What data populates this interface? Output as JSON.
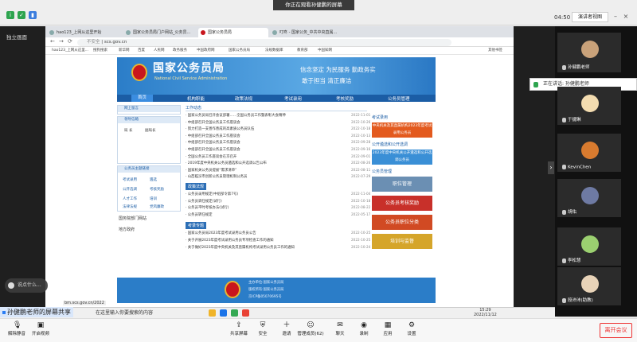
{
  "meeting": {
    "share_banner": "你正在观看孙健鹏的屏幕",
    "time": "04:50",
    "layout_label": "演讲者视图",
    "self_tag": "独立画面",
    "speaking_text": "正在讲话: 孙健鹏老师",
    "sharing_label": "孙健鹏老师的屏幕共享",
    "speech_bubble": "说点什么...",
    "end_button": "离开会议"
  },
  "browser": {
    "tabs": [
      "hao123_上网从这里开始",
      "国家公务员局门户网站_公务员...",
      "国家公务员局",
      "叮咚 - 国家公务_中共中央直属..."
    ],
    "url": "scs.gov.cn",
    "secure_label": "不安全",
    "bookmarks": [
      "hao123_上网从这里...",
      "搜狗搜索",
      "新华网",
      "百度",
      "人民网",
      "政务服务",
      "中国政府网",
      "国家公务员局",
      "法规数据库",
      "教育部",
      "中国知网",
      "其他书签"
    ]
  },
  "site": {
    "title_cn": "国家公务员局",
    "title_en": "National Civil Service Administration",
    "slogan_1": "信念坚定  为民服务  勤政务实",
    "slogan_2": "敢于担当  清正廉洁",
    "nav": [
      "首页",
      "机构职能",
      "政策法规",
      "考试录用",
      "考核奖励",
      "公务员管理"
    ],
    "left_box1_title": "网上留言",
    "left_box2_title": "领导信箱",
    "left_box2_items": [
      "局 长",
      "副局长"
    ],
    "left_box3_title": "公务员主题链接",
    "left_links": [
      "考试录用",
      "遴选",
      "公开选调",
      "考核奖励",
      "人才工作",
      "培训",
      "法律法规",
      "党风廉政"
    ],
    "left_extra": [
      "国务院部门网站",
      "地方政府"
    ],
    "work_news_title": "工作动态",
    "work_news": [
      {
        "t": "国家公务员局召开会议部署……全国公务员工作暨表彰大会精神",
        "d": "2022-11-01"
      },
      {
        "t": "中组部召开全国公务员工作座谈会",
        "d": "2022-10-26"
      },
      {
        "t": "努力打造一支善作善成的高素质公务员队伍",
        "d": "2022-10-18"
      },
      {
        "t": "中组部召开全国公务员工作座谈会",
        "d": "2022-10-13"
      },
      {
        "t": "中组部召开全国公务员工作座谈会",
        "d": "2022-09-28"
      },
      {
        "t": "中组部召开全国公务员工作座谈会",
        "d": "2022-09-16"
      },
      {
        "t": "全国公务员工作座谈会在京召开",
        "d": "2022-09-01"
      },
      {
        "t": "2019年度中央机关公务员遴选和公开选调公告公布",
        "d": "2022-08-26"
      },
      {
        "t": "国家机关公务员提拔“需求清单”",
        "d": "2022-08-11"
      },
      {
        "t": "山西临汾市创新公务员管理机制公务员",
        "d": "2022-07-29"
      }
    ],
    "policy_title": "政策法规",
    "policy_news": [
      {
        "t": "公务员录用规定(中组部令第7号)",
        "d": "2022-11-04"
      },
      {
        "t": "公务员调任规定(试行)",
        "d": "2022-10-18"
      },
      {
        "t": "公务员平时考核办法(试行)",
        "d": "2022-08-22"
      },
      {
        "t": "公务员转任规定",
        "d": "2022-05-17"
      }
    ],
    "exam_title": "考录专题",
    "exam_news": [
      {
        "t": "国家公务员局2023年度考试录用公务员公告",
        "d": "2022-10-25"
      },
      {
        "t": "关于开展2023年度考试录用公务员专项检查工作的通知",
        "d": "2022-10-25"
      },
      {
        "t": "关于做好2023年度中央机关及其直属机构考试录用公务员工作的通知",
        "d": "2022-10-24"
      }
    ],
    "right_title_1": "考试录用",
    "right_title_2": "公开遴选和公开选调",
    "right_title_3": "公务员管理",
    "right_banners": [
      "中央机关及其直属机构2023年度考试录用公务员",
      "2023年度中央机关公开遴选和公开选调公务员",
      "职位管理",
      "公务员考核奖励",
      "公务员职位分类",
      "培训与监督"
    ],
    "footer_lines": [
      "主办单位:国家公务员局",
      "版权所有:国家公务员局",
      "京ICP备05070695号"
    ]
  },
  "taskbar": {
    "search": "在这里输入你要搜索的内容",
    "time": "15:29",
    "date": "2022/11/12",
    "url_status": "bm.scs.gov.cn/2022"
  },
  "participants": [
    {
      "name": "孙健鹏老师",
      "role": "host"
    },
    {
      "name": "于捷琳"
    },
    {
      "name": "KevinChen"
    },
    {
      "name": "胡佑"
    },
    {
      "name": "李松慧"
    },
    {
      "name": "段沛沛(助教)"
    }
  ],
  "toolbar": [
    {
      "label": "解除静音",
      "icon": "mic"
    },
    {
      "label": "开启视频",
      "icon": "video"
    },
    {
      "label": "共享屏幕",
      "icon": "share"
    },
    {
      "label": "安全",
      "icon": "shield"
    },
    {
      "label": "邀请",
      "icon": "invite"
    },
    {
      "label": "管理成员(62)",
      "icon": "members"
    },
    {
      "label": "聊天",
      "icon": "chat"
    },
    {
      "label": "录制",
      "icon": "record"
    },
    {
      "label": "应用",
      "icon": "apps"
    },
    {
      "label": "设置",
      "icon": "gear"
    }
  ]
}
